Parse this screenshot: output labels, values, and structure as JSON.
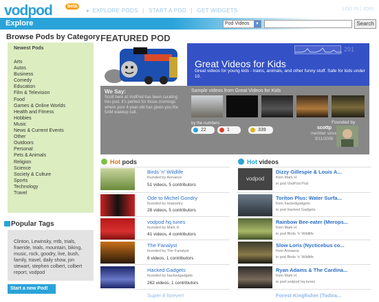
{
  "header": {
    "logo": "vodpod",
    "logo_badge": "beta",
    "nav": [
      "EXPLORE PODS",
      "START A POD",
      "GET WIDGETS"
    ],
    "nav_separator": "|",
    "top_right": "LOG IN | JOIN"
  },
  "explore_bar": {
    "title": "Explore",
    "search_select": "Pod Videos",
    "search_placeholder": "",
    "search_button": "Search"
  },
  "sidebar": {
    "browse_title": "Browse Pods by Category",
    "newest": "Newest Pods",
    "categories": [
      "Arts",
      "Autos",
      "Business",
      "Comedy",
      "Education",
      "Film & Television",
      "Food",
      "Games & Online Worlds",
      "Health and Fitness",
      "Hobbies",
      "Music",
      "News & Current Events",
      "Other",
      "Outdoors",
      "Personal",
      "Pets & Animals",
      "Religion",
      "Science",
      "Society & Culture",
      "Sports",
      "Technology",
      "Travel"
    ],
    "popular_title": "Popular Tags",
    "tags": "Clinton, Lewinsky, mtb, trials, fraeride, trials, mountain, biking, music, rock, goodry, live, bush, family, travel, daily show, jon stewart, stephen colbert, colbert report, vodpod",
    "start_button": "Start a new Pod!"
  },
  "featured": {
    "heading": "FEATURED POD",
    "pod_title": "Great Videos for Kids",
    "pod_desc": "Great videos for young kids - trains, animals, and other funny stuff. Safe for kids under 10.",
    "spark_value": "291",
    "we_say_title": "We Say:",
    "we_say_text": "Scott here at VodPod has been curating this pod. It's perfect for those mornings where your 4-year-old has given you the 5AM wakeup call.",
    "samples_title": "Sample videos from Great Videos for Kids",
    "by_numbers": "by the numbers",
    "stats": [
      "22",
      "1",
      "339"
    ],
    "founded_by": "Founded by",
    "founder": "scottp",
    "founder_role": "member since",
    "founder_date": "9/11/2006"
  },
  "hot_pods": {
    "title_em": "Hot",
    "title_rest": " pods",
    "items": [
      {
        "title": "Birds 'n' Wildlife",
        "founded": "founded by Annaeos",
        "videos": "51 videos, 5 contributors"
      },
      {
        "title": "Ode to Michel Gondry",
        "founded": "founded by mepoetry",
        "videos": "28 videos, 5 contributors"
      },
      {
        "title": "vodpod hq tunes",
        "founded": "founded by Mark H",
        "videos": "41 videos, 4 contributors"
      },
      {
        "title": "The Fanalyst",
        "founded": "founded by The Fanalyst",
        "videos": "6 videos, 1 contributors"
      },
      {
        "title": "Hacked Gadgets",
        "founded": "founded by hackedgadgets",
        "videos": "262 videos, 1 contributors"
      },
      {
        "title": "Super 8 forever!",
        "founded": "",
        "videos": ""
      }
    ]
  },
  "hot_videos": {
    "title_em": "Hot",
    "title_rest": " videos",
    "items": [
      {
        "title": "Dizzy Gillespie & Louis A...",
        "from": "from Mark H",
        "pod": "in pod VodPod Pod"
      },
      {
        "title": "Toriton Plus: Water Surfa...",
        "from": "from hackedgadgets",
        "pod": "in pod Hacked Gadgets"
      },
      {
        "title": "Rainbow Bee-eater (Merops...",
        "from": "from Mark H",
        "pod": "in pod Birds 'n' Wildlife"
      },
      {
        "title": "Slow Loris (Nycticebus co...",
        "from": "from Annaeos",
        "pod": "in pod Birds 'n' Wildlife"
      },
      {
        "title": "Ryan Adams & The Cardina...",
        "from": "from Mark H",
        "pod": "in pod vodpod hq tunes"
      },
      {
        "title": "Forest Kingfisher (Todira...",
        "from": "",
        "pod": ""
      }
    ]
  },
  "colors": {
    "brand_blue": "#2aa3d9",
    "hot_orange": "#e0711d",
    "featured_blue": "#3451c6",
    "sidebar_green": "#dcedc0"
  }
}
